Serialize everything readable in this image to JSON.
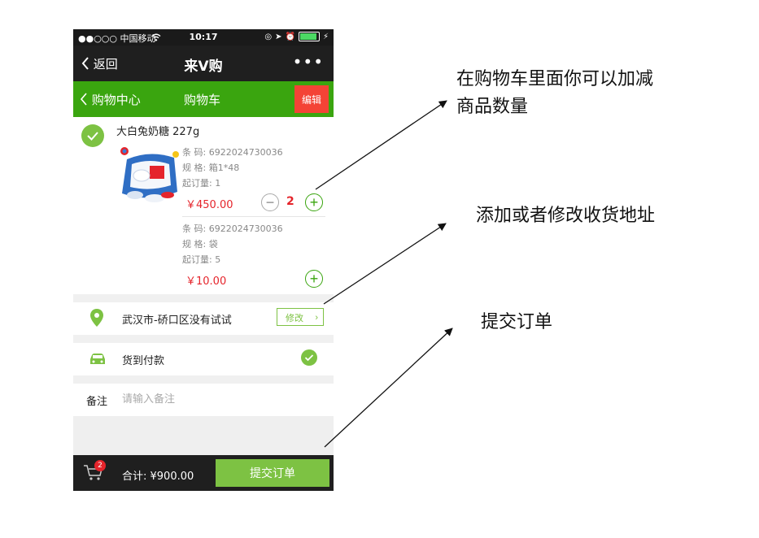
{
  "status_bar": {
    "carrier": "●●○○○ 中国移动",
    "time": "10:17"
  },
  "nav": {
    "back_label": "返回",
    "title": "来V购",
    "more_label": "•••"
  },
  "subnav": {
    "back_label": "购物中心",
    "title": "购物车",
    "edit_label": "编辑"
  },
  "product": {
    "name": "大白兔奶糖 227g",
    "variants": [
      {
        "barcode": "条  码:  6922024730036",
        "spec": "规  格:  箱1*48",
        "min_order": "起订量:  1",
        "price": "￥450.00",
        "quantity": "2"
      },
      {
        "barcode": "条  码:  6922024730036",
        "spec": "规  格:  袋",
        "min_order": "起订量:  5",
        "price": "￥10.00"
      }
    ]
  },
  "address": {
    "text": "武汉市-硚口区没有试试",
    "modify_label": "修改"
  },
  "payment": {
    "label": "货到付款"
  },
  "remark": {
    "label": "备注",
    "placeholder": "请输入备注"
  },
  "footer": {
    "cart_badge": "2",
    "total": "合计:  ¥900.00",
    "submit_label": "提交订单"
  },
  "annotations": {
    "cart": [
      "在购物车里面你可以加减",
      "商品数量"
    ],
    "address": "添加或者修改收货地址",
    "submit": "提交订单"
  },
  "colors": {
    "brand_green": "#3aa50f",
    "light_green": "#7dc243",
    "price_red": "#e5242b",
    "edit_red": "#f44336"
  },
  "icons": [
    "wifi-icon",
    "battery-icon",
    "back-chevron-icon",
    "more-icon",
    "check-icon",
    "product-image",
    "minus-icon",
    "plus-icon",
    "location-pin-icon",
    "car-icon",
    "cart-icon",
    "arrow-icon"
  ]
}
